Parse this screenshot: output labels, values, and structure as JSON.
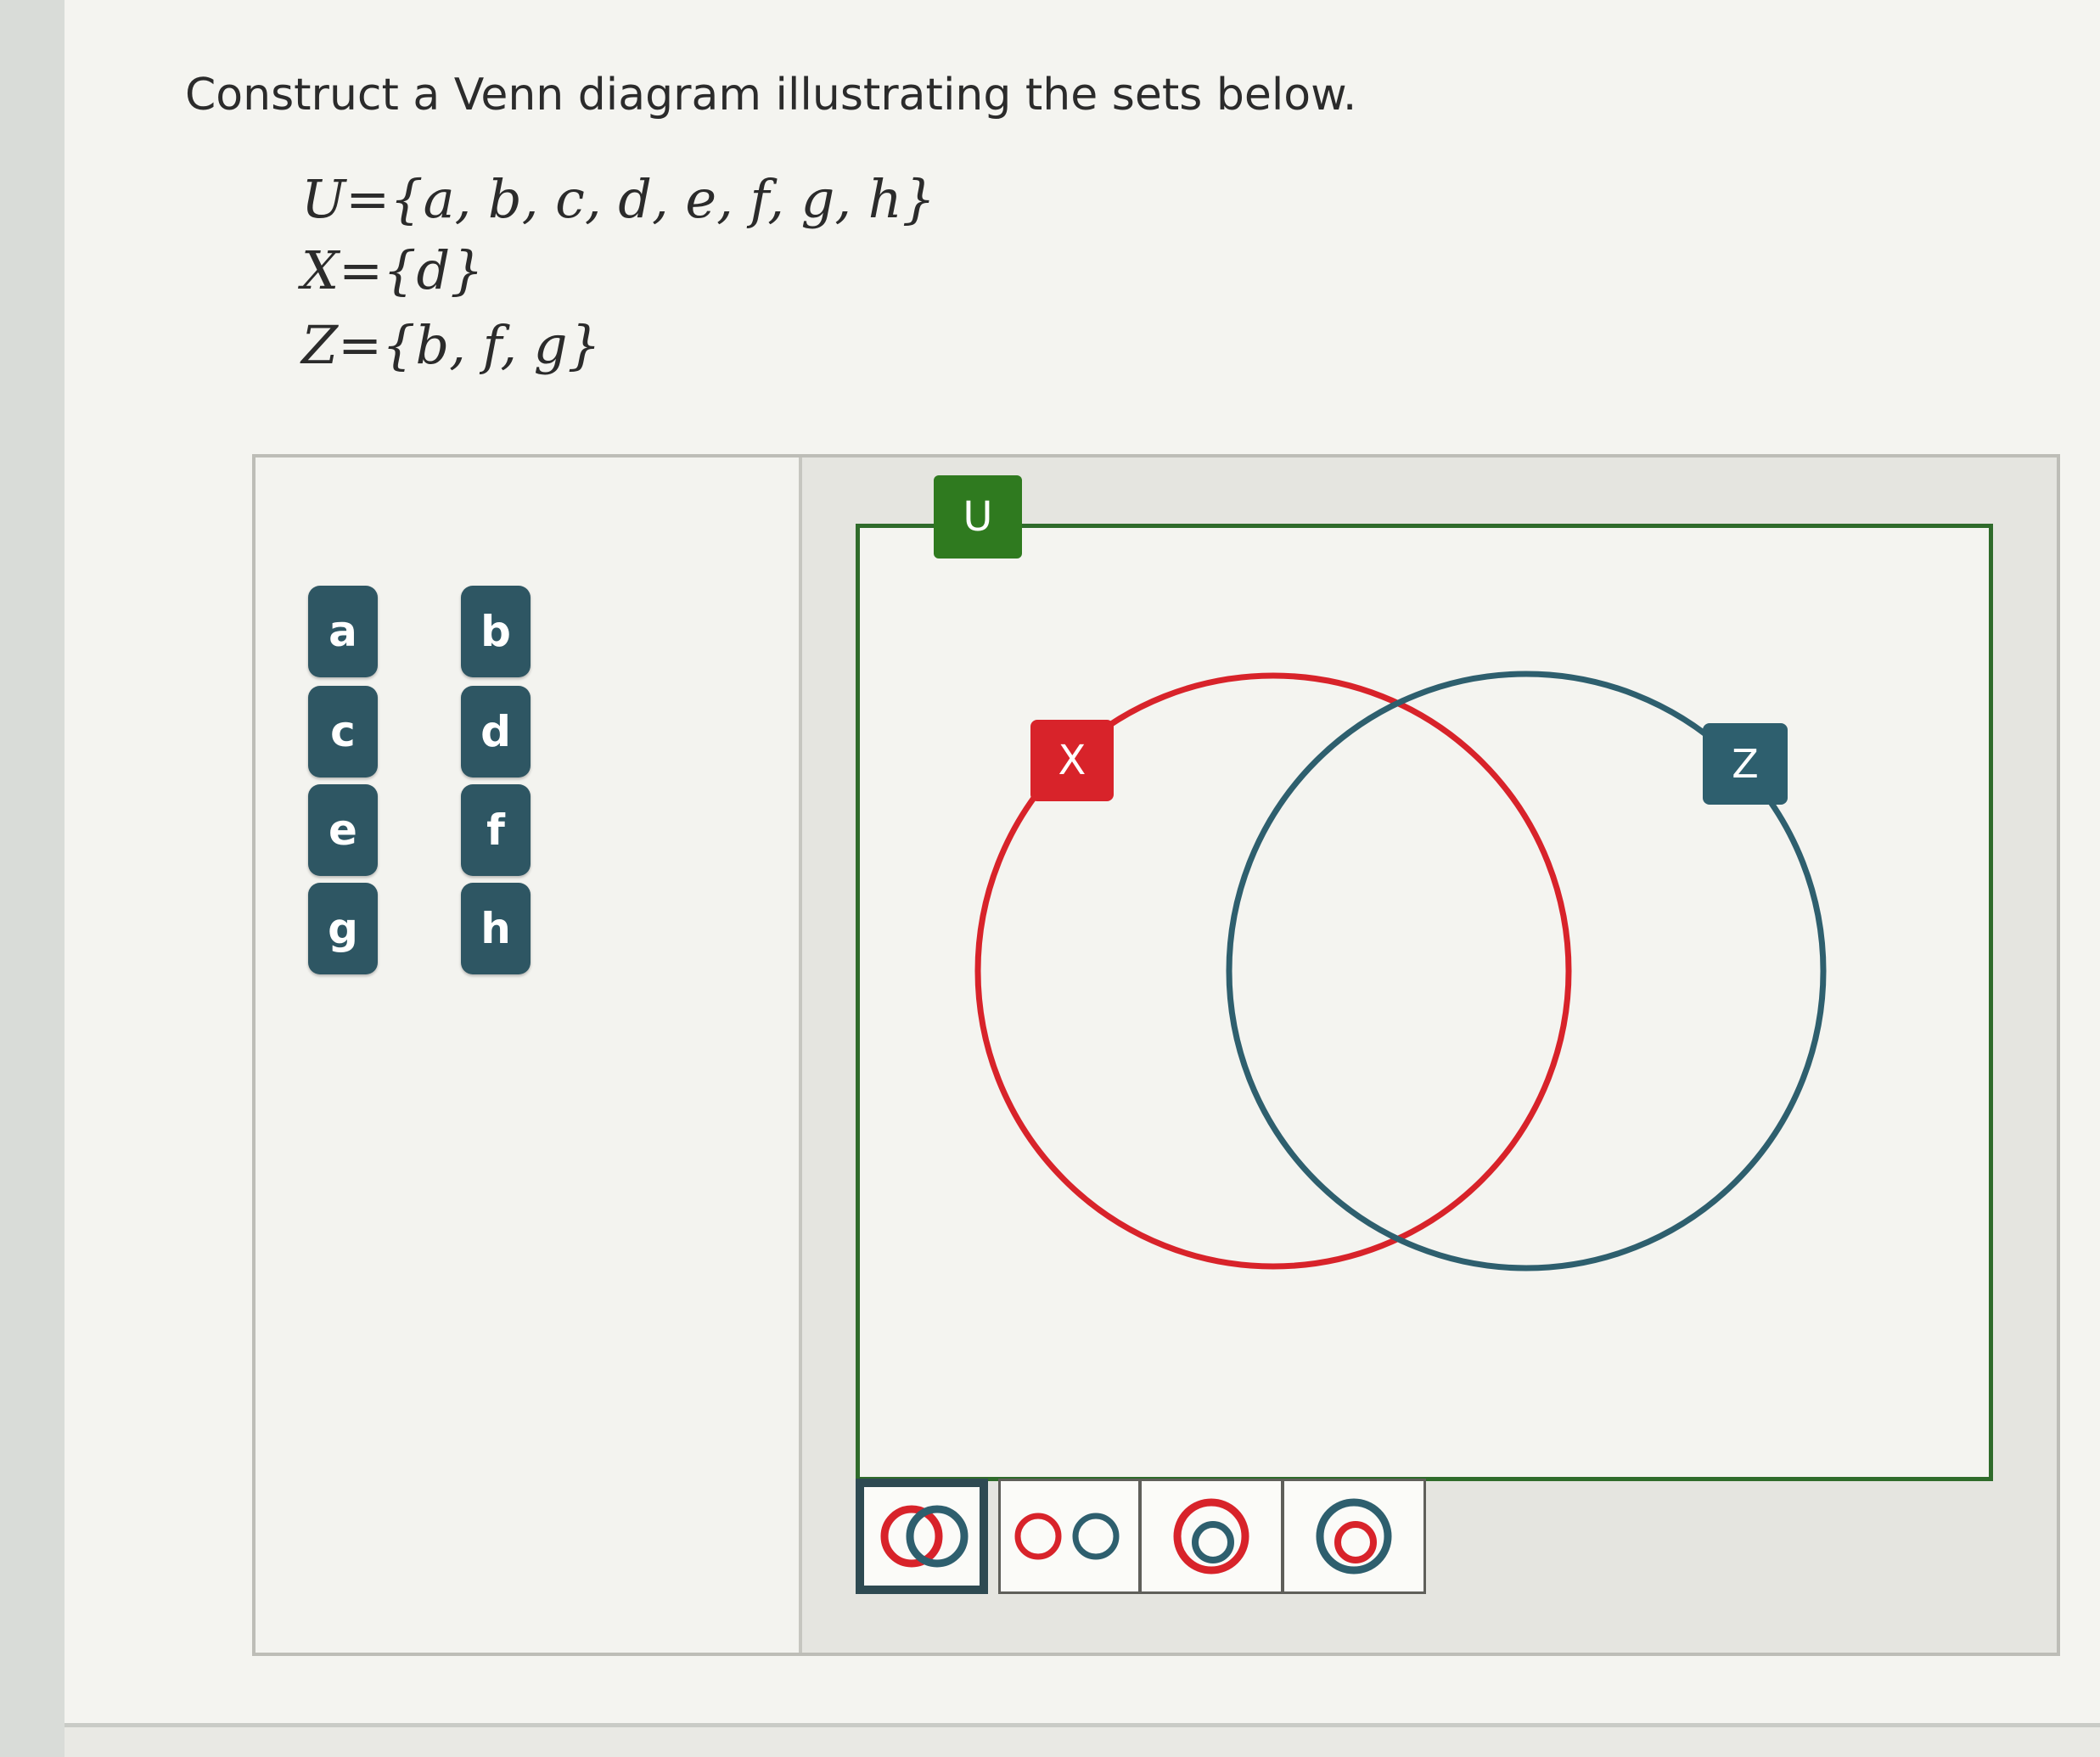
{
  "question": {
    "instruction": "Construct a Venn diagram illustrating the sets below.",
    "sets": [
      {
        "id": "U",
        "text": "U={a, b, c, d, e, f, g, h}"
      },
      {
        "id": "X",
        "text": "X={d}"
      },
      {
        "id": "Z",
        "text": "Z={b, f, g}"
      }
    ]
  },
  "palette": {
    "chips": [
      "a",
      "b",
      "c",
      "d",
      "e",
      "f",
      "g",
      "h"
    ]
  },
  "diagram": {
    "universe_label": "U",
    "circle_labels": [
      "X",
      "Z"
    ],
    "colors": {
      "universe": "#2f7a1f",
      "x_circle": "#d8232a",
      "z_circle": "#2e5f6e",
      "chip": "#2e5663"
    }
  },
  "tools": [
    {
      "icon": "overlapping-circles-icon",
      "selected": true
    },
    {
      "icon": "separate-circles-icon",
      "selected": false
    },
    {
      "icon": "z-inside-x-icon",
      "selected": false
    },
    {
      "icon": "x-inside-z-icon",
      "selected": false
    }
  ]
}
